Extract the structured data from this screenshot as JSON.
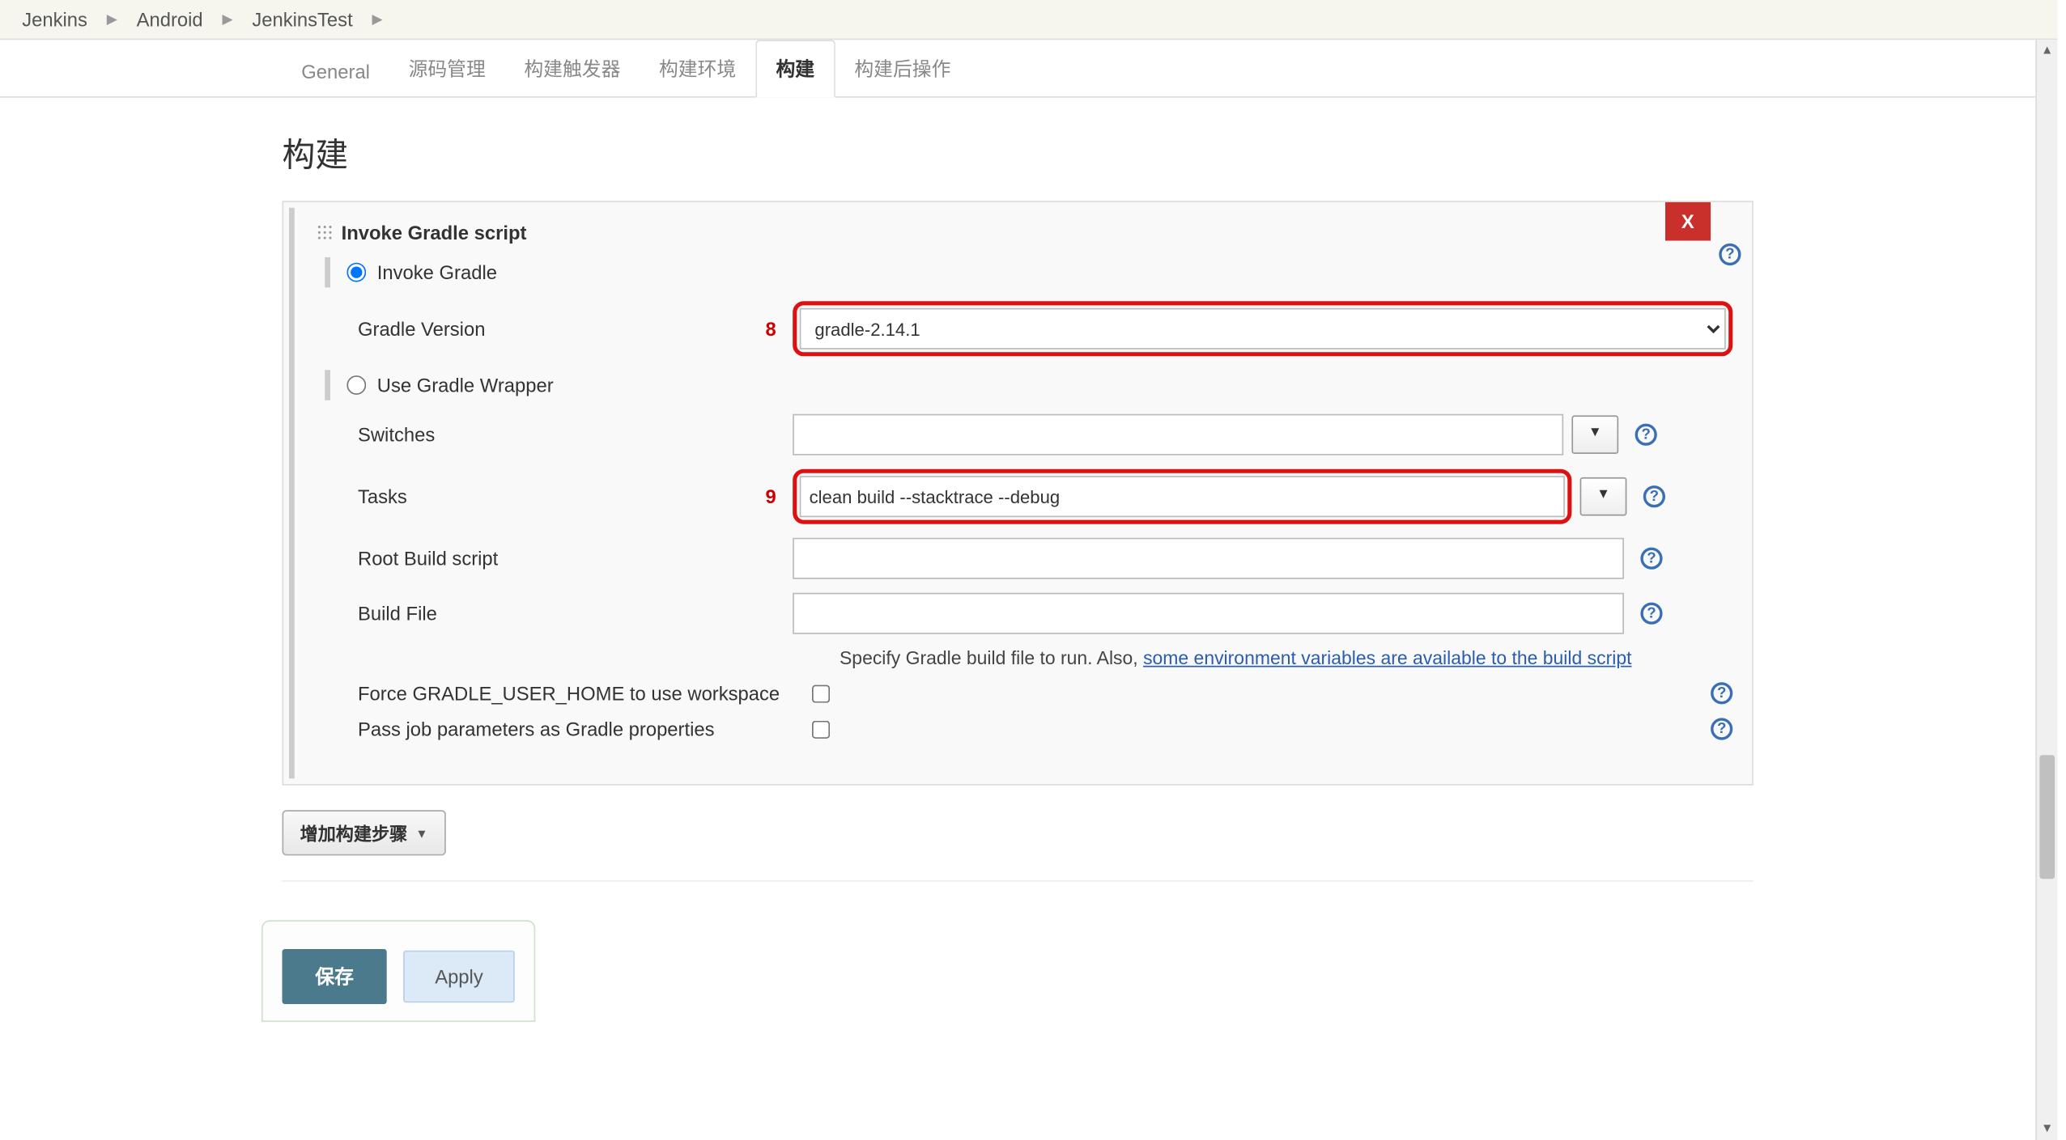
{
  "breadcrumb": [
    "Jenkins",
    "Android",
    "JenkinsTest"
  ],
  "tabs": {
    "general": "General",
    "scm": "源码管理",
    "trigger": "构建触发器",
    "env": "构建环境",
    "build": "构建",
    "post": "构建后操作"
  },
  "section_title": "构建",
  "block": {
    "title": "Invoke Gradle script",
    "delete_label": "X",
    "radio_invoke": "Invoke Gradle",
    "radio_wrapper": "Use Gradle Wrapper",
    "gradle_version_label": "Gradle Version",
    "gradle_version_value": "gradle-2.14.1",
    "switches_label": "Switches",
    "switches_value": "",
    "tasks_label": "Tasks",
    "tasks_value": "clean build --stacktrace --debug",
    "root_script_label": "Root Build script",
    "root_script_value": "",
    "build_file_label": "Build File",
    "build_file_value": "",
    "build_file_desc_pre": "Specify Gradle build file to run. Also, ",
    "build_file_desc_link": "some environment variables are available to the build script",
    "force_home_label": "Force GRADLE_USER_HOME to use workspace",
    "pass_params_label": "Pass job parameters as Gradle properties"
  },
  "annotations": {
    "gradle_version": "8",
    "tasks": "9"
  },
  "add_step_label": "增加构建步骤",
  "buttons": {
    "save": "保存",
    "apply": "Apply"
  }
}
